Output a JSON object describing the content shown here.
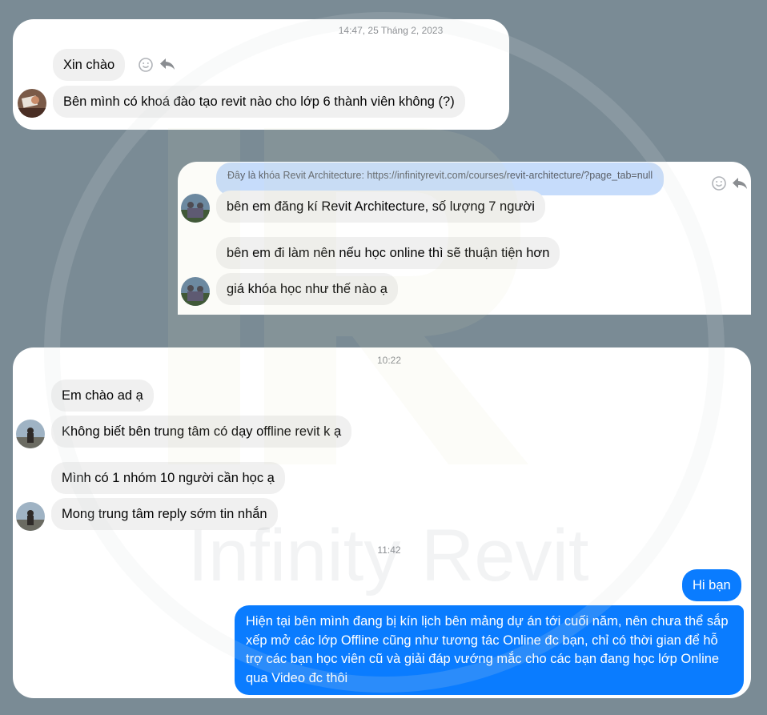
{
  "panel1": {
    "timestamp": "14:47, 25 Tháng 2, 2023",
    "messages": [
      "Xin chào",
      "Bên mình có khoá đào tạo revit nào cho lớp 6 thành viên không (?)"
    ]
  },
  "panel2": {
    "reply_quote": "Đây là khóa Revit Architecture: https://infinityrevit.com/courses/revit-architecture/?page_tab=null",
    "messages": [
      "bên em đăng kí Revit Architecture, số lượng 7 người",
      "bên em đi làm nên nếu học online thì sẽ thuận tiện hơn",
      "giá khóa học như thế nào ạ"
    ]
  },
  "panel3": {
    "timestamp_1": "10:22",
    "messages": [
      "Em chào ad ạ",
      "Không biết bên trung tâm có dạy offline revit k ạ",
      "Mình có 1 nhóm 10 người cần học ạ",
      "Mong trung tâm reply sớm tin nhắn"
    ],
    "timestamp_2": "11:42",
    "replies": [
      "Hi bạn",
      "Hiện tại bên mình đang bị kín lịch bên mảng dự án tới cuối năm, nên chưa thể sắp xếp mở các lớp Offline cũng như tương tác Online đc bạn, chỉ có thời gian để hỗ trợ các bạn học viên cũ và giải đáp vướng mắc cho các bạn đang học lớp Online qua Video đc thôi"
    ]
  },
  "watermark": {
    "text": "Infinity Revit",
    "logo_letters": "IR"
  },
  "colors": {
    "background": "#7a8b95",
    "incoming_bubble": "#f0f0f0",
    "outgoing_bubble": "#0a7cff",
    "reply_quote": "#c6dcfb"
  },
  "icons": [
    "emoji-icon",
    "reply-icon"
  ]
}
